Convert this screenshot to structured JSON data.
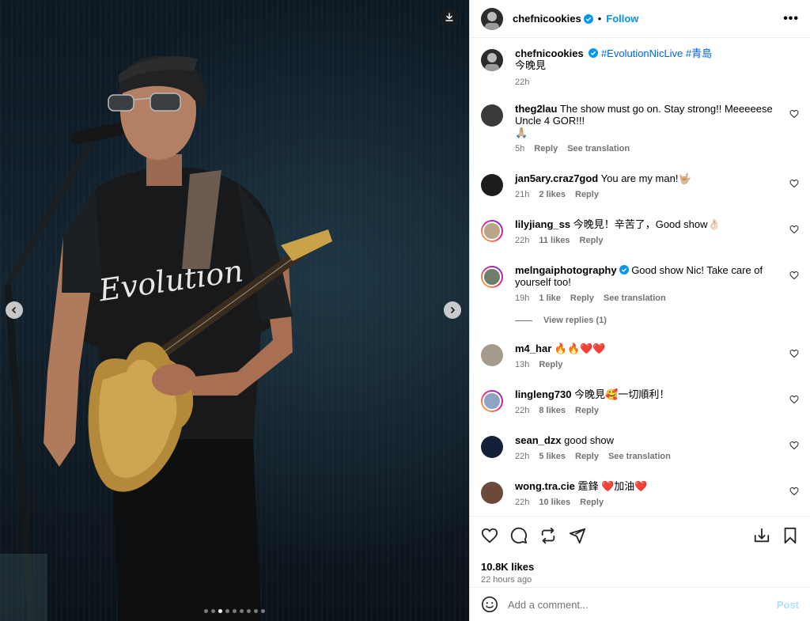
{
  "media": {
    "shirt_text": "Evolution",
    "carousel_count": 9,
    "carousel_active": 3,
    "icons": {
      "download": "download-icon",
      "prev": "chevron-left-icon",
      "next": "chevron-right-icon"
    }
  },
  "header": {
    "username": "chefnicookies",
    "separator": "•",
    "follow_label": "Follow",
    "more_label": "•••"
  },
  "caption": {
    "username": "chefnicookies",
    "hashtags": "#EvolutionNicLive #青島",
    "text": "今晚見",
    "time": "22h"
  },
  "comments": [
    {
      "username": "theg2lau",
      "text": "The show must go on. Stay strong!! Meeeeese Uncle 4 GOR!!!",
      "text2": "🙏🏼",
      "time": "5h",
      "likes": "",
      "reply": "Reply",
      "translate": "See translation",
      "avatar_color": "#3a3a3a",
      "ring": false
    },
    {
      "username": "jan5ary.craz7god",
      "text": "You are my man!🤟🏼",
      "time": "21h",
      "likes": "2 likes",
      "reply": "Reply",
      "translate": "",
      "avatar_color": "#1c1c1c",
      "ring": false
    },
    {
      "username": "lilyjiang_ss",
      "text": "今晚見！辛苦了，Good show👌🏻",
      "time": "22h",
      "likes": "11 likes",
      "reply": "Reply",
      "translate": "",
      "avatar_color": "#b9a58a",
      "ring": true
    },
    {
      "username": "melngaiphotography",
      "text": "Good show Nic! Take care of yourself too!",
      "time": "19h",
      "likes": "1 like",
      "reply": "Reply",
      "translate": "See translation",
      "avatar_color": "#6f7d6a",
      "ring": true,
      "verified": true
    },
    {
      "username": "m4_har",
      "text": "🔥🔥❤️❤️",
      "time": "13h",
      "likes": "",
      "reply": "Reply",
      "translate": "",
      "avatar_color": "#a59b8c",
      "ring": false
    },
    {
      "username": "lingleng730",
      "text": "今晚見🥰一切順利！",
      "time": "22h",
      "likes": "8 likes",
      "reply": "Reply",
      "translate": "",
      "avatar_color": "#8fa3c4",
      "ring": true
    },
    {
      "username": "sean_dzx",
      "text": "good show",
      "time": "22h",
      "likes": "5 likes",
      "reply": "Reply",
      "translate": "See translation",
      "avatar_color": "#142038",
      "ring": false
    },
    {
      "username": "wong.tra.cie",
      "text": "霆鋒 ❤️加油❤️",
      "time": "22h",
      "likes": "10 likes",
      "reply": "Reply",
      "translate": "",
      "avatar_color": "#6b4a3a",
      "ring": false
    }
  ],
  "view_replies": "View replies (1)",
  "likes_count": "10.8K likes",
  "posted_ago": "22 hours ago",
  "comment_input": {
    "placeholder": "Add a comment...",
    "post_label": "Post"
  },
  "colors": {
    "follow": "#0095f6",
    "verified": "#0095f6",
    "post_disabled": "#b2dffc",
    "secondary_text": "#737373"
  }
}
